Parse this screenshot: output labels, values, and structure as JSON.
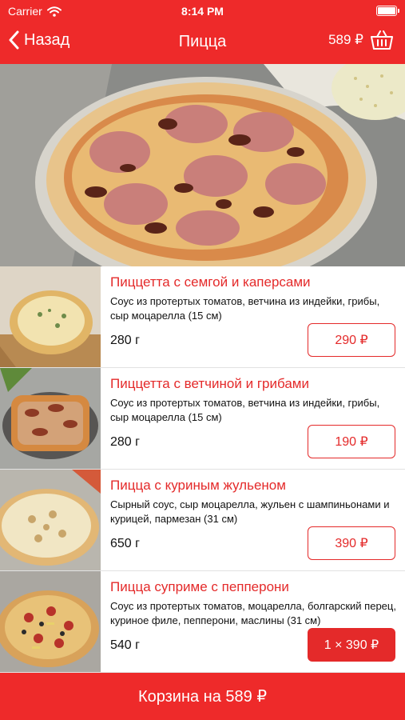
{
  "status": {
    "carrier": "Carrier",
    "time": "8:14 PM"
  },
  "nav": {
    "back_label": "Назад",
    "title": "Пицца",
    "cart_total": "589 ₽"
  },
  "products": [
    {
      "name": "Пиццетта с семгой и каперсами",
      "description": "Соус из протертых томатов, ветчина из индейки, грибы, сыр моцарелла (15 см)",
      "weight": "280 г",
      "price": "290 ₽"
    },
    {
      "name": "Пиццетта с ветчиной и грибами",
      "description": "Соус из протертых томатов, ветчина из индейки, грибы, сыр моцарелла (15 см)",
      "weight": "280 г",
      "price": "190 ₽"
    },
    {
      "name": "Пицца с куриным жульеном",
      "description": "Сырный соус, сыр моцарелла, жульен с шампиньонами и курицей, пармезан (31 см)",
      "weight": "650 г",
      "price": "390 ₽"
    },
    {
      "name": "Пицца суприме с пепперони",
      "description": "Соус из протертых томатов, моцарелла, болгарский перец, куриное филе, пепперони, маслины (31 см)",
      "weight": "540 г",
      "price": "1 × 390 ₽"
    }
  ],
  "bottom_bar": {
    "label": "Корзина на 589 ₽"
  },
  "colors": {
    "accent": "#ee2a2a",
    "text": "#111111",
    "divider": "#e2e2e2"
  },
  "icons": {
    "wifi": "wifi-icon",
    "battery": "battery-icon",
    "back": "chevron-left-icon",
    "cart": "basket-icon"
  }
}
